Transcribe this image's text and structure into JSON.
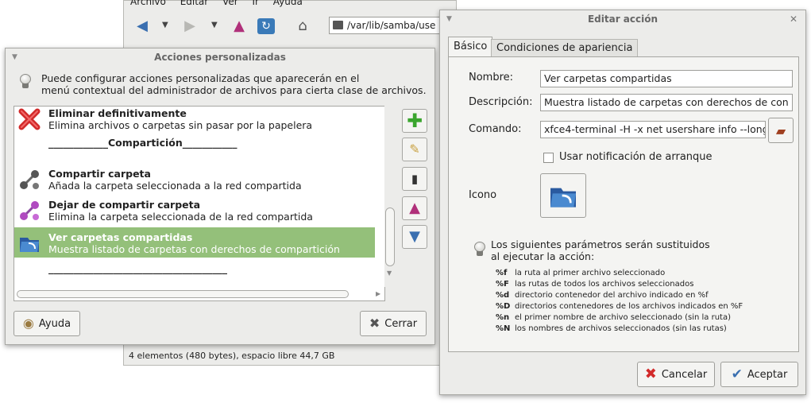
{
  "file_manager": {
    "menu": [
      "Archivo",
      "Editar",
      "Ver",
      "Ir",
      "Ayuda"
    ],
    "path": "/var/lib/samba/use",
    "status": "4 elementos (480 bytes), espacio libre 44,7 GB"
  },
  "acciones_dialog": {
    "title": "Acciones personalizadas",
    "intro_line1": "Puede configurar acciones personalizadas que aparecerán en el",
    "intro_line2": "menú contextual del administrador de archivos para cierta clase de archivos.",
    "items": [
      {
        "title": "Eliminar definitivamente",
        "desc": "Elimina archivos o carpetas sin pasar por la papelera",
        "icon": "delete-x-icon"
      },
      {
        "title": "Compartir carpeta",
        "desc": "Añada la carpeta seleccionada a la red compartida",
        "icon": "network-share-icon"
      },
      {
        "title": "Dejar de compartir carpeta",
        "desc": "Elimina la carpeta seleccionada de la red compartida",
        "icon": "network-unshare-icon"
      },
      {
        "title": "Ver carpetas compartidas",
        "desc": "Muestra listado de carpetas con derechos de compartición",
        "icon": "shared-folders-icon",
        "selected": true
      }
    ],
    "separator_label": "Compartición",
    "separator_line1": "____________Compartición___________",
    "separator_line2": "____________________________________",
    "help_button": "Ayuda",
    "close_button": "Cerrar"
  },
  "edit_dialog": {
    "title": "Editar acción",
    "tabs": [
      "Básico",
      "Condiciones de apariencia"
    ],
    "fields": {
      "name_label": "Nombre:",
      "name_value": "Ver carpetas compartidas",
      "desc_label": "Descripción:",
      "desc_value": "Muestra listado de carpetas con derechos de con",
      "command_label": "Comando:",
      "command_value": "xfce4-terminal -H -x net usershare info --long"
    },
    "startup_notification_label": "Usar notificación de arranque",
    "startup_notification_checked": false,
    "icon_label": "Icono",
    "params_intro_line1": "Los siguientes parámetros serán sustituidos",
    "params_intro_line2": "al ejecutar la acción:",
    "params": [
      {
        "code": "%f",
        "desc": "la ruta al primer archivo seleccionado"
      },
      {
        "code": "%F",
        "desc": "las rutas de todos los archivos seleccionados"
      },
      {
        "code": "%d",
        "desc": "directorio contenedor del archivo indicado en %f"
      },
      {
        "code": "%D",
        "desc": "directorios contenedores de los archivos indicados en %F"
      },
      {
        "code": "%n",
        "desc": "el primer nombre de archivo seleccionado (sin la ruta)"
      },
      {
        "code": "%N",
        "desc": "los nombres de archivos seleccionados (sin las rutas)"
      }
    ],
    "cancel_button": "Cancelar",
    "accept_button": "Aceptar"
  },
  "colors": {
    "selection": "#94c07a",
    "window_bg": "#ececea",
    "arrow_blue": "#3a6fb0",
    "arrow_magenta": "#b0307a",
    "add_green": "#3aa52e",
    "cancel_red": "#d22a2a"
  }
}
